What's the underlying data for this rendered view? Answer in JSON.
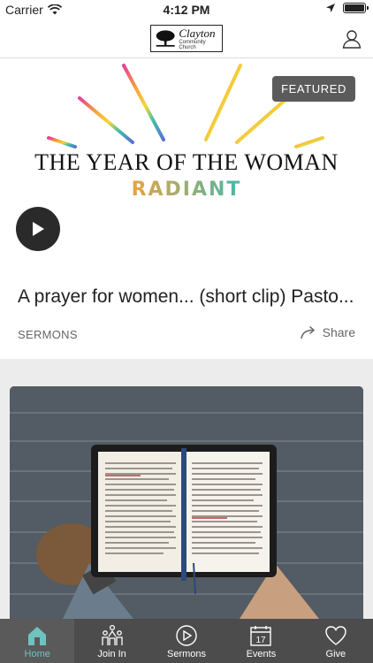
{
  "status_bar": {
    "carrier": "Carrier",
    "time": "4:12 PM"
  },
  "header": {
    "logo_title": "Clayton",
    "logo_subtitle": "Community Church",
    "profile_icon": "person-icon"
  },
  "featured": {
    "badge": "FEATURED",
    "hero_title": "THE YEAR OF THE WOMAN",
    "hero_subtitle": "RADIANT",
    "title": "A prayer for women... (short clip) Pasto...",
    "category": "SERMONS",
    "share_label": "Share"
  },
  "tabs": [
    {
      "label": "Home",
      "icon": "home-icon",
      "active": true
    },
    {
      "label": "Join In",
      "icon": "people-icon",
      "active": false
    },
    {
      "label": "Sermons",
      "icon": "play-circle-icon",
      "active": false
    },
    {
      "label": "Events",
      "icon": "calendar-icon",
      "active": false,
      "calendar_day": "17"
    },
    {
      "label": "Give",
      "icon": "heart-icon",
      "active": false
    }
  ],
  "colors": {
    "accent": "#6fc2c0",
    "tab_bar": "#4c4c4c",
    "badge": "#5b5b5b"
  }
}
